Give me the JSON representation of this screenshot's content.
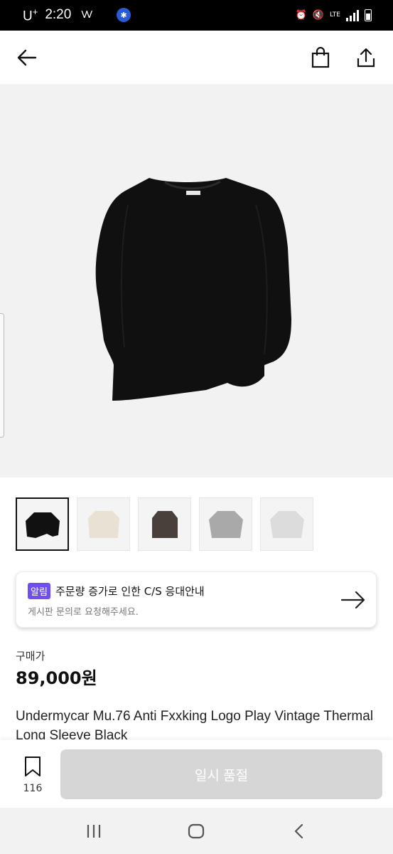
{
  "status_bar": {
    "carrier": "U",
    "carrier_suffix": "+",
    "time": "2:20",
    "network": "LTE"
  },
  "header": {
    "back_icon": "arrow-left-icon",
    "bag_icon": "shopping-bag-icon",
    "share_icon": "share-icon"
  },
  "thumbnails": [
    {
      "color": "#111111",
      "selected": true
    },
    {
      "color": "#e9e2d4",
      "selected": false
    },
    {
      "color": "#4a403b",
      "selected": false
    },
    {
      "color": "#a9a9a9",
      "selected": false
    },
    {
      "color": "#dcdcdc",
      "selected": false
    }
  ],
  "notice": {
    "badge": "알림",
    "title": "주문량 증가로 인한 C/S 응대안내",
    "subtitle": "게시판 문의로 요청해주세요.",
    "arrow_icon": "arrow-right-icon"
  },
  "product": {
    "price_label": "구매가",
    "price": "89,000원",
    "title": "Undermycar Mu.76 Anti Fxxking Logo Play Vintage Thermal Long Sleeve Black"
  },
  "action_bar": {
    "bookmark_icon": "bookmark-icon",
    "bookmark_count": "116",
    "button_label": "일시 품절"
  },
  "nav": {
    "recents_icon": "recents-icon",
    "home_icon": "home-icon",
    "back_icon": "nav-back-icon"
  },
  "colors": {
    "accent": "#6f4ff2",
    "soldout": "#d6d6d6"
  }
}
